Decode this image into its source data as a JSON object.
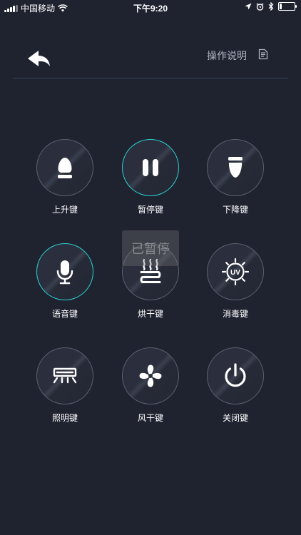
{
  "status_bar": {
    "carrier": "中国移动",
    "time": "下午9:20",
    "battery_level": 0.15
  },
  "header": {
    "back_icon": "back-arrow-icon",
    "manual_label": "操作说明",
    "manual_icon": "document-icon"
  },
  "colors": {
    "background": "#1f2330",
    "active_ring": "#2ad2d3",
    "ring": "#5b6070",
    "divider": "#3a4457"
  },
  "controls": [
    {
      "label": "上升键",
      "icon": "raise-icon",
      "active": false
    },
    {
      "label": "暂停键",
      "icon": "pause-icon",
      "active": true
    },
    {
      "label": "下降键",
      "icon": "lower-icon",
      "active": false
    },
    {
      "label": "语音键",
      "icon": "microphone-icon",
      "active": true
    },
    {
      "label": "烘干键",
      "icon": "heat-dry-icon",
      "active": false
    },
    {
      "label": "消毒键",
      "icon": "uv-sterilize-icon",
      "active": false
    },
    {
      "label": "照明键",
      "icon": "light-icon",
      "active": false
    },
    {
      "label": "风干键",
      "icon": "fan-icon",
      "active": false
    },
    {
      "label": "关闭键",
      "icon": "power-icon",
      "active": false
    }
  ],
  "toast": {
    "text": "已暂停"
  }
}
